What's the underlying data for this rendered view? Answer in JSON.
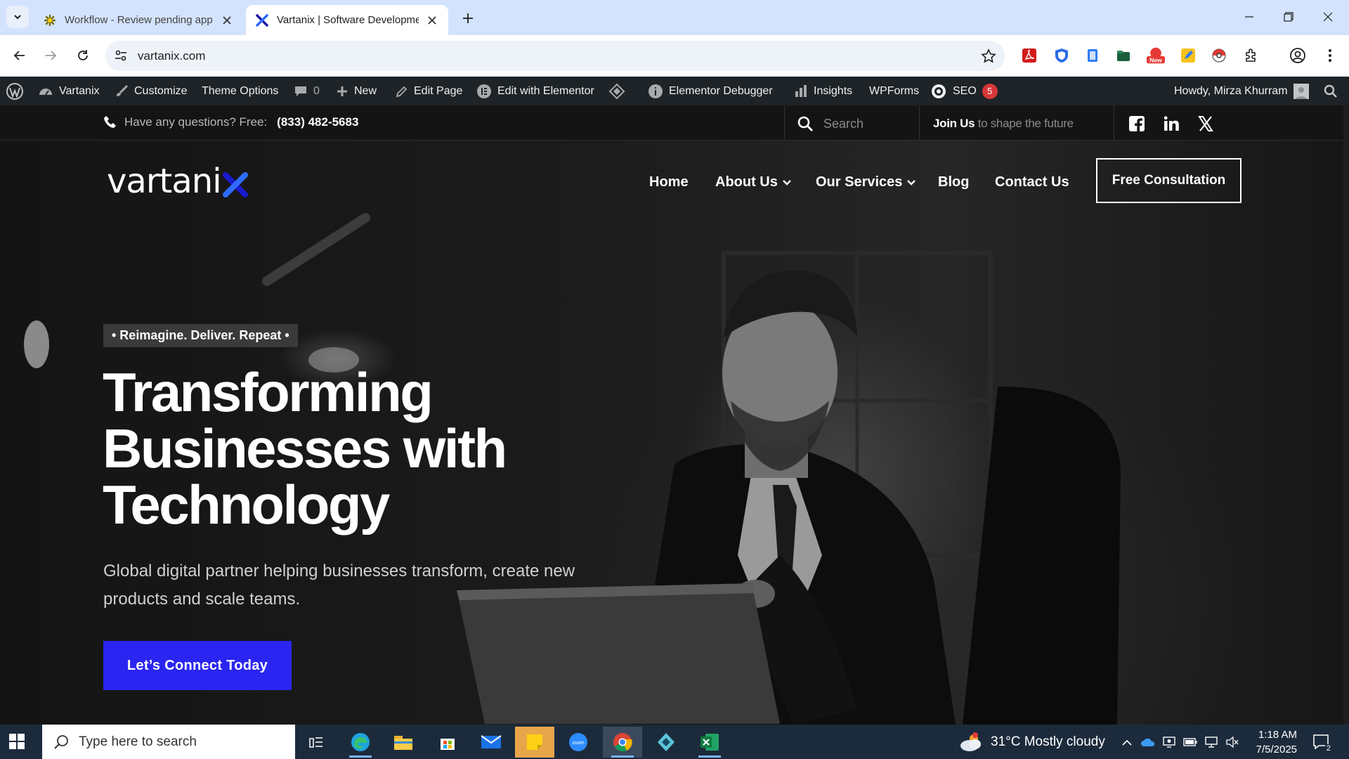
{
  "browser": {
    "tabs": [
      {
        "title": "Workflow - Review pending app",
        "active": false,
        "favicon": "workflow-icon"
      },
      {
        "title": "Vartanix | Software Developmen",
        "active": true,
        "favicon": "vartanix-x-icon"
      }
    ],
    "url": "vartanix.com"
  },
  "wp_admin_bar": {
    "site_name": "Vartanix",
    "customize": "Customize",
    "theme_options": "Theme Options",
    "comments_count": "0",
    "new": "New",
    "edit_page": "Edit Page",
    "edit_elementor": "Edit with Elementor",
    "debugger": "Elementor Debugger",
    "insights": "Insights",
    "wpforms": "WPForms",
    "seo": "SEO",
    "seo_badge": "5",
    "howdy": "Howdy, Mirza Khurram"
  },
  "topbar": {
    "question": "Have any questions? Free:",
    "phone": "(833) 482-5683",
    "search_placeholder": "Search",
    "join_bold": "Join Us",
    "join_rest": " to shape the future"
  },
  "header": {
    "logo": "vartani",
    "logo_x": "x",
    "nav": {
      "home": "Home",
      "about": "About Us",
      "services": "Our Services",
      "blog": "Blog",
      "contact": "Contact Us"
    },
    "consult": "Free Consultation"
  },
  "hero": {
    "tagline": "• Reimagine. Deliver. Repeat •",
    "title_l1": "Transforming",
    "title_l2": "Businesses with",
    "title_l3": "Technology",
    "subtitle": "Global digital partner helping businesses transform, create new products and scale teams.",
    "cta": "Let’s Connect Today"
  },
  "taskbar": {
    "search_placeholder": "Type here to search",
    "weather": "31°C  Mostly cloudy",
    "time": "1:18 AM",
    "date": "7/5/2025",
    "notifications": "2"
  },
  "colors": {
    "accent_blue": "#2a25f0",
    "wp_bar": "#1d2327",
    "tab_strip": "#d3e3fd",
    "taskbar": "#1c2b3c"
  }
}
